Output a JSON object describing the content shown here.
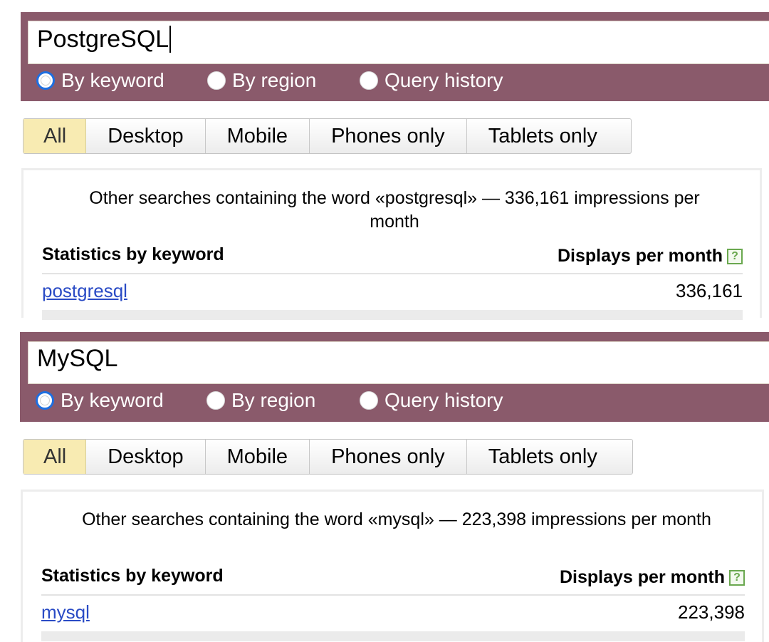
{
  "panels": [
    {
      "query": "PostgreSQL",
      "radios": [
        {
          "label": "By keyword",
          "checked": true
        },
        {
          "label": "By region",
          "checked": false
        },
        {
          "label": "Query history",
          "checked": false
        }
      ],
      "tabs": [
        {
          "label": "All",
          "active": true
        },
        {
          "label": "Desktop",
          "active": false
        },
        {
          "label": "Mobile",
          "active": false
        },
        {
          "label": "Phones only",
          "active": false
        },
        {
          "label": "Tablets only",
          "active": false
        }
      ],
      "summary": "Other searches containing the word «postgresql» — 336,161 impressions per month",
      "col_keyword": "Statistics by keyword",
      "col_displays": "Displays per month",
      "help_glyph": "?",
      "rows": [
        {
          "keyword": "postgresql",
          "count": "336,161"
        }
      ]
    },
    {
      "query": "MySQL",
      "radios": [
        {
          "label": "By keyword",
          "checked": true
        },
        {
          "label": "By region",
          "checked": false
        },
        {
          "label": "Query history",
          "checked": false
        }
      ],
      "tabs": [
        {
          "label": "All",
          "active": true
        },
        {
          "label": "Desktop",
          "active": false
        },
        {
          "label": "Mobile",
          "active": false
        },
        {
          "label": "Phones only",
          "active": false
        },
        {
          "label": "Tablets only",
          "active": false
        }
      ],
      "summary": "Other searches containing the word «mysql» — 223,398 impressions per month",
      "col_keyword": "Statistics by keyword",
      "col_displays": "Displays per month",
      "help_glyph": "?",
      "rows": [
        {
          "keyword": "mysql",
          "count": "223,398"
        }
      ]
    }
  ],
  "colors": {
    "search_band": "#8a5a6b",
    "radio_checked": "#1e6fe0",
    "active_tab": "#f8ebb2",
    "link": "#2a4bc5",
    "help_icon": "#6aa84f"
  }
}
